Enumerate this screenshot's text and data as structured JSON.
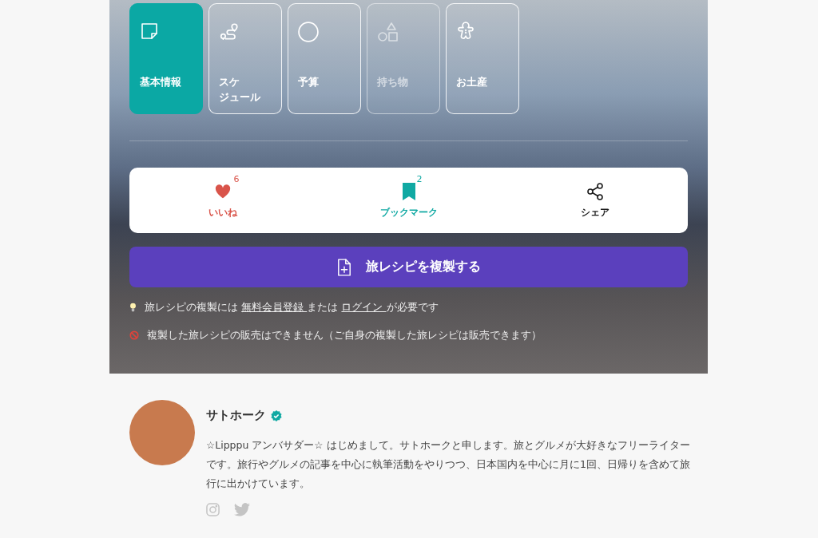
{
  "tabs": [
    {
      "label": "基本情報",
      "selected": true,
      "disabled": false
    },
    {
      "lines": [
        "スケ",
        "ジュール"
      ],
      "selected": false,
      "disabled": false
    },
    {
      "label": "予算",
      "selected": false,
      "disabled": false
    },
    {
      "label": "持ち物",
      "selected": false,
      "disabled": true
    },
    {
      "label": "お土産",
      "selected": false,
      "disabled": false
    }
  ],
  "actions": [
    {
      "kind": "like",
      "label": "いいね",
      "count": "6",
      "color": "#d9544a"
    },
    {
      "kind": "bookmark",
      "label": "ブックマーク",
      "count": "2",
      "color": "#10a9a3"
    },
    {
      "kind": "share",
      "label": "シェア",
      "color": "#1a1a1a"
    }
  ],
  "copy_button": {
    "label": "旅レシピを複製する"
  },
  "notes": [
    {
      "kind": "info",
      "parts": [
        {
          "text": "旅レシピの複製には "
        },
        {
          "link": "無料会員登録 "
        },
        {
          "text": "または "
        },
        {
          "link": "ログイン "
        },
        {
          "text": "が必要です"
        }
      ]
    },
    {
      "kind": "prohibited",
      "parts": [
        {
          "text": "複製した旅レシピの販売はできません（ご自身の複製した旅レシピは販売できます）"
        }
      ]
    }
  ],
  "author": {
    "name": "サトホーク",
    "verified": true,
    "bio": "☆Lipppu アンバサダー☆ はじめまして。サトホークと申します。旅とグルメが大好きなフリーライターです。旅行やグルメの記事を中心に執筆活動をやりつつ、日本国内を中心に月に1回、日帰りを含めて旅行に出かけています。",
    "social": [
      {
        "kind": "instagram"
      },
      {
        "kind": "twitter"
      }
    ]
  }
}
